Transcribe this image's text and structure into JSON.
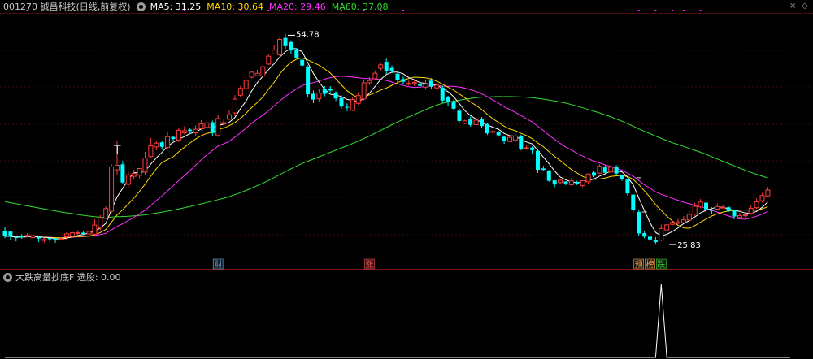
{
  "header": {
    "stock_title": "001270 铖昌科技(日线,前复权)",
    "ma_labels": [
      {
        "text": "MA5: 31.25",
        "color": "#ffffff"
      },
      {
        "text": "MA10: 30.64",
        "color": "#ffd700"
      },
      {
        "text": "MA20: 29.46",
        "color": "#ff30ff"
      },
      {
        "text": "MA60: 37.08",
        "color": "#33dd33"
      }
    ],
    "corner_close": "×",
    "corner_diamond": "◇"
  },
  "sub_panel": {
    "title": "大跌高量抄底F 选股: 0.00",
    "collapse_icon": "chevron-down-icon"
  },
  "chart_data": [
    {
      "type": "candlestick",
      "title": "001270 铖昌科技(日线,前复权)",
      "ylim": [
        23.5,
        57.5
      ],
      "colors": {
        "up": "#ff3c3c",
        "down": "#00ffff",
        "ma5": "#ffffff",
        "ma10": "#ffd700",
        "ma20": "#ff30ff",
        "ma60": "#33dd33"
      },
      "annotations": [
        {
          "text": "54.78",
          "x": 50,
          "y": 54.78,
          "type": "high"
        },
        {
          "text": "25.83",
          "x": 118,
          "y": 25.83,
          "type": "low"
        }
      ],
      "event_labels": [
        {
          "text": "财",
          "x": 38,
          "color": "#6ab0ff"
        },
        {
          "text": "涨",
          "x": 65,
          "color": "#ff5050"
        },
        {
          "text": "预",
          "x": 113,
          "color": "#ff9d3a"
        },
        {
          "text": "榜",
          "x": 115,
          "color": "#ff9d3a"
        },
        {
          "text": "跌",
          "x": 117,
          "color": "#33dd33"
        }
      ],
      "top_markers_x": [
        4,
        32,
        42,
        47,
        49,
        60,
        64,
        67,
        71,
        113,
        116,
        119,
        121,
        124
      ],
      "t_marker": {
        "text": "T",
        "x": 20
      },
      "x": [
        0,
        1,
        2,
        3,
        4,
        5,
        6,
        7,
        8,
        9,
        10,
        11,
        12,
        13,
        14,
        15,
        16,
        17,
        18,
        19,
        20,
        21,
        22,
        23,
        24,
        25,
        26,
        27,
        28,
        29,
        30,
        31,
        32,
        33,
        34,
        35,
        36,
        37,
        38,
        39,
        40,
        41,
        42,
        43,
        44,
        45,
        46,
        47,
        48,
        49,
        50,
        51,
        52,
        53,
        54,
        55,
        56,
        57,
        58,
        59,
        60,
        61,
        62,
        63,
        64,
        65,
        66,
        67,
        68,
        69,
        70,
        71,
        72,
        73,
        74,
        75,
        76,
        77,
        78,
        79,
        80,
        81,
        82,
        83,
        84,
        85,
        86,
        87,
        88,
        89,
        90,
        91,
        92,
        93,
        94,
        95,
        96,
        97,
        98,
        99,
        100,
        101,
        102,
        103,
        104,
        105,
        106,
        107,
        108,
        109,
        110,
        111,
        112,
        113,
        114,
        115,
        116,
        117,
        118,
        119,
        120,
        121,
        122,
        123,
        124,
        125,
        126,
        127,
        128,
        129,
        130,
        131,
        132,
        133,
        134,
        135,
        136,
        137,
        138,
        139,
        140
      ],
      "open": [
        27.7,
        27.61,
        26.88,
        26.98,
        27.0,
        26.8,
        26.83,
        26.52,
        26.73,
        26.67,
        26.5,
        26.89,
        26.94,
        27.4,
        27.47,
        27.28,
        27.25,
        28.1,
        29.43,
        30.4,
        36.09,
        36.84,
        34.1,
        35.2,
        35.34,
        35.77,
        37.91,
        39.23,
        39.86,
        39.15,
        40.6,
        40.18,
        41.17,
        41.61,
        41.16,
        41.73,
        41.91,
        42.61,
        40.8,
        42.41,
        43.05,
        43.9,
        46.32,
        47.23,
        48.81,
        49.0,
        48.96,
        50.6,
        52.0,
        51.89,
        54.2,
        53.62,
        52.5,
        51.19,
        50.2,
        46.53,
        45.84,
        47.24,
        47.25,
        46.71,
        45.95,
        44.73,
        44.26,
        45.21,
        45.81,
        48.04,
        48.59,
        50.02,
        50.91,
        50.07,
        49.29,
        48.55,
        47.85,
        47.92,
        47.86,
        47.43,
        48.33,
        47.33,
        47.37,
        46.09,
        45.48,
        44.2,
        42.47,
        43.09,
        42.28,
        43.02,
        42.37,
        41.27,
        41.29,
        40.63,
        39.98,
        40.18,
        40.73,
        39.03,
        39.14,
        38.69,
        36.28,
        35.91,
        34.64,
        34.34,
        34.49,
        34.05,
        34.42,
        33.92,
        34.43,
        35.72,
        35.63,
        36.42,
        35.79,
        36.48,
        35.42,
        34.75,
        32.68,
        30.3,
        27.39,
        26.92,
        26.51,
        26.44,
        27.84,
        28.61,
        28.75,
        28.83,
        29.2,
        30.03,
        31.01,
        31.58,
        30.64,
        30.69,
        30.95,
        30.95,
        30.52,
        29.55,
        29.78,
        30.11,
        30.89,
        31.84,
        32.51
      ],
      "close": [
        26.99,
        26.92,
        26.73,
        26.81,
        27.07,
        27.06,
        26.65,
        26.52,
        26.56,
        26.49,
        26.62,
        27.3,
        27.45,
        27.47,
        27.29,
        27.63,
        28.51,
        29.48,
        30.76,
        36.49,
        36.71,
        34.35,
        35.4,
        35.58,
        36.26,
        37.71,
        39.38,
        39.75,
        39.24,
        40.65,
        40.32,
        41.52,
        41.47,
        41.41,
        41.66,
        42.41,
        42.53,
        41.14,
        43.12,
        42.56,
        43.66,
        45.79,
        47.27,
        48.37,
        49.49,
        49.34,
        50.25,
        51.68,
        52.52,
        53.99,
        53.06,
        52.48,
        51.48,
        50.4,
        46.46,
        45.72,
        46.63,
        46.52,
        46.98,
        45.88,
        44.77,
        44.62,
        45.73,
        46.28,
        48.02,
        48.34,
        49.34,
        50.5,
        49.65,
        49.6,
        48.44,
        48.17,
        47.94,
        48.06,
        47.61,
        47.87,
        47.5,
        47.71,
        45.6,
        45.38,
        44.48,
        42.79,
        42.81,
        42.25,
        42.9,
        42.1,
        41.09,
        41.36,
        40.83,
        40.09,
        40.55,
        40.74,
        39.0,
        39.12,
        38.79,
        36.1,
        36.08,
        34.58,
        34.07,
        34.66,
        34.21,
        34.56,
        34.2,
        34.59,
        35.51,
        35.28,
        36.57,
        35.68,
        36.46,
        35.58,
        34.82,
        32.85,
        30.54,
        27.36,
        26.92,
        26.53,
        26.17,
        28.03,
        28.54,
        28.86,
        28.95,
        29.22,
        29.98,
        31.08,
        31.66,
        30.66,
        30.46,
        31.04,
        30.95,
        30.47,
        29.68,
        29.79,
        29.9,
        30.81,
        31.7,
        32.55,
        33.31
      ],
      "high": [
        28.3,
        27.68,
        27.0,
        27.26,
        27.39,
        27.32,
        26.96,
        26.74,
        26.82,
        26.75,
        26.81,
        27.53,
        27.6,
        27.79,
        27.62,
        27.8,
        29.29,
        29.89,
        31.08,
        36.89,
        40.05,
        37.3,
        35.97,
        36.13,
        36.33,
        38.57,
        40.48,
        40.11,
        40.12,
        41.21,
        40.72,
        41.91,
        42.06,
        41.81,
        42.17,
        42.9,
        43.01,
        42.85,
        43.61,
        43.12,
        44.25,
        46.33,
        47.6,
        48.89,
        49.64,
        49.79,
        50.64,
        52.04,
        53.26,
        54.39,
        54.78,
        53.87,
        52.8,
        51.48,
        50.42,
        46.96,
        47.17,
        47.58,
        47.58,
        46.86,
        46.32,
        45.19,
        46.1,
        46.77,
        48.51,
        48.81,
        49.71,
        50.82,
        51.33,
        50.41,
        49.46,
        48.88,
        48.33,
        48.41,
        47.99,
        48.36,
        48.69,
        47.85,
        47.65,
        46.24,
        45.7,
        44.51,
        42.95,
        43.4,
        43.27,
        43.34,
        42.58,
        41.63,
        41.42,
        40.75,
        40.8,
        40.99,
        40.92,
        39.46,
        39.29,
        38.97,
        36.63,
        36.08,
        34.66,
        34.84,
        34.53,
        34.97,
        34.61,
        34.65,
        35.59,
        35.95,
        36.84,
        36.69,
        36.63,
        36.73,
        35.45,
        34.9,
        32.73,
        30.56,
        27.73,
        27.13,
        26.86,
        28.55,
        28.67,
        29.13,
        29.37,
        29.7,
        30.47,
        31.59,
        32.07,
        31.71,
        30.95,
        31.47,
        31.32,
        31.04,
        30.0,
        30.18,
        30.27,
        31.17,
        32.16,
        32.91,
        33.72
      ],
      "low": [
        26.69,
        26.48,
        26.27,
        26.61,
        26.82,
        26.54,
        26.18,
        26.06,
        26.2,
        26.07,
        26.45,
        26.42,
        26.85,
        26.92,
        27.13,
        27.11,
        27.09,
        27.81,
        29.34,
        30.16,
        35.37,
        34.11,
        33.67,
        34.75,
        34.91,
        35.42,
        37.7,
        38.77,
        38.86,
        38.93,
        40.0,
        39.93,
        40.97,
        40.96,
        40.79,
        41.52,
        41.75,
        40.77,
        40.64,
        42.17,
        42.9,
        43.45,
        46.06,
        47.05,
        48.65,
        48.9,
        48.56,
        50.5,
        51.96,
        51.73,
        52.69,
        51.98,
        51.38,
        50.16,
        46.06,
        45.24,
        45.42,
        46.18,
        46.73,
        45.54,
        44.5,
        44.14,
        44.12,
        45.03,
        45.6,
        47.75,
        48.45,
        49.66,
        49.26,
        49.37,
        48.1,
        47.89,
        47.64,
        47.59,
        47.21,
        47.08,
        47.2,
        46.91,
        45.26,
        44.91,
        44.23,
        42.57,
        42.33,
        42.01,
        42.05,
        41.79,
        40.87,
        40.96,
        40.75,
        39.65,
        39.89,
        39.98,
        38.75,
        38.97,
        38.28,
        35.66,
        35.99,
        34.45,
        33.68,
        34.14,
        33.97,
        33.9,
        33.99,
        33.72,
        34.16,
        35.1,
        35.54,
        35.6,
        35.56,
        35.29,
        34.57,
        32.56,
        30.17,
        27.08,
        26.71,
        25.83,
        25.9,
        26.31,
        28.19,
        28.49,
        28.61,
        28.97,
        29.09,
        29.76,
        30.81,
        30.37,
        30.05,
        30.49,
        30.83,
        30.28,
        29.28,
        29.31,
        29.57,
        29.91,
        30.7,
        31.59,
        32.31
      ]
    },
    {
      "type": "line",
      "title": "大跌高量抄底F 选股: 0.00",
      "x": [
        0,
        1,
        2,
        3,
        4,
        5,
        6,
        7,
        8,
        9,
        10,
        11,
        12,
        13,
        14,
        15,
        16,
        17,
        18,
        19,
        20,
        21,
        22,
        23,
        24,
        25,
        26,
        27,
        28,
        29,
        30,
        31,
        32,
        33,
        34,
        35,
        36,
        37,
        38,
        39,
        40,
        41,
        42,
        43,
        44,
        45,
        46,
        47,
        48,
        49,
        50,
        51,
        52,
        53,
        54,
        55,
        56,
        57,
        58,
        59,
        60,
        61,
        62,
        63,
        64,
        65,
        66,
        67,
        68,
        69,
        70,
        71,
        72,
        73,
        74,
        75,
        76,
        77,
        78,
        79,
        80,
        81,
        82,
        83,
        84,
        85,
        86,
        87,
        88,
        89,
        90,
        91,
        92,
        93,
        94,
        95,
        96,
        97,
        98,
        99,
        100,
        101,
        102,
        103,
        104,
        105,
        106,
        107,
        108,
        109,
        110,
        111,
        112,
        113,
        114,
        115,
        116,
        117,
        118,
        119,
        120,
        121,
        122,
        123,
        124,
        125,
        126,
        127,
        128,
        129,
        130,
        131,
        132,
        133,
        134,
        135,
        136,
        137,
        138,
        139,
        140
      ],
      "values": [
        0,
        0,
        0,
        0,
        0,
        0,
        0,
        0,
        0,
        0,
        0,
        0,
        0,
        0,
        0,
        0,
        0,
        0,
        0,
        0,
        0,
        0,
        0,
        0,
        0,
        0,
        0,
        0,
        0,
        0,
        0,
        0,
        0,
        0,
        0,
        0,
        0,
        0,
        0,
        0,
        0,
        0,
        0,
        0,
        0,
        0,
        0,
        0,
        0,
        0,
        0,
        0,
        0,
        0,
        0,
        0,
        0,
        0,
        0,
        0,
        0,
        0,
        0,
        0,
        0,
        0,
        0,
        0,
        0,
        0,
        0,
        0,
        0,
        0,
        0,
        0,
        0,
        0,
        0,
        0,
        0,
        0,
        0,
        0,
        0,
        0,
        0,
        0,
        0,
        0,
        0,
        0,
        0,
        0,
        0,
        0,
        0,
        0,
        0,
        0,
        0,
        0,
        0,
        0,
        0,
        0,
        0,
        0,
        0,
        0,
        0,
        0,
        0,
        0,
        0,
        0,
        0,
        1,
        0,
        0,
        0,
        0,
        0,
        0,
        0,
        0,
        0,
        0,
        0,
        0,
        0,
        0,
        0,
        0,
        0,
        0,
        0,
        0,
        0,
        0,
        0
      ],
      "ylim": [
        0,
        1
      ],
      "color": "#ffffff"
    }
  ]
}
